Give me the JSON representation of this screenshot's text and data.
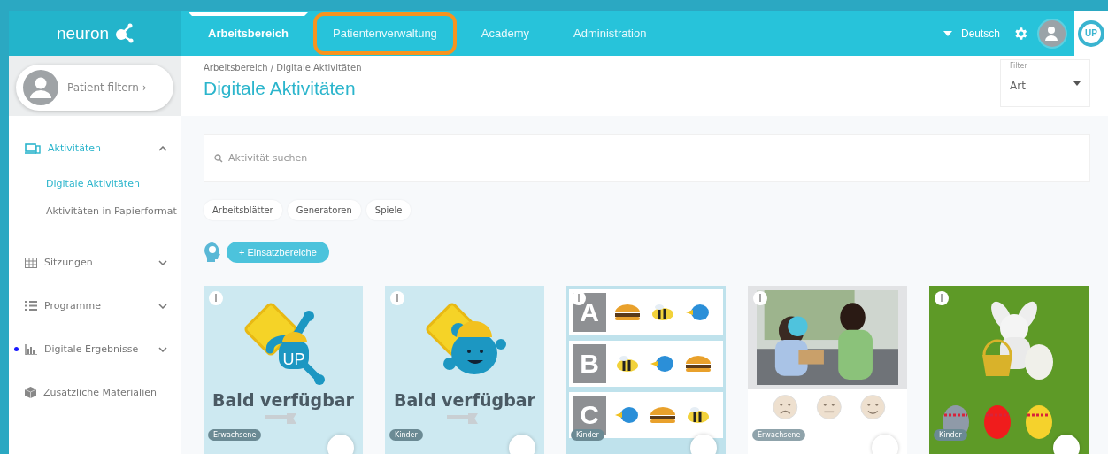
{
  "header": {
    "logo": "neuron",
    "nav": [
      {
        "label": "Arbeitsbereich",
        "selected": true,
        "highlighted": false
      },
      {
        "label": "Patientenverwaltung",
        "selected": false,
        "highlighted": true
      },
      {
        "label": "Academy",
        "selected": false,
        "highlighted": false
      },
      {
        "label": "Administration",
        "selected": false,
        "highlighted": false
      }
    ],
    "language": "Deutsch",
    "brand_badge": "UP"
  },
  "sidebar": {
    "patient_filter": "Patient filtern ›",
    "items": [
      {
        "label": "Aktivitäten",
        "kind": "activities",
        "expanded": true,
        "selected": true,
        "notification": false,
        "children": [
          {
            "label": "Digitale Aktivitäten",
            "selected": true
          },
          {
            "label": "Aktivitäten in Papierformat",
            "selected": false
          }
        ]
      },
      {
        "label": "Sitzungen",
        "kind": "sessions",
        "expanded": false,
        "selected": false,
        "notification": false
      },
      {
        "label": "Programme",
        "kind": "programs",
        "expanded": false,
        "selected": false,
        "notification": false
      },
      {
        "label": "Digitale Ergebnisse",
        "kind": "results",
        "expanded": false,
        "selected": false,
        "notification": true
      },
      {
        "label": "Zusätzliche Materialien",
        "kind": "materials",
        "selected": false,
        "notification": false
      }
    ]
  },
  "breadcrumb": "Arbeitsbereich / Digitale Aktivitäten",
  "page_title": "Digitale Aktivitäten",
  "filter": {
    "label": "Filter",
    "value": "Art"
  },
  "search": {
    "placeholder": "Aktivität suchen"
  },
  "chips": [
    "Arbeitsblätter",
    "Generatoren",
    "Spiele"
  ],
  "areas_button": "+ Einsatzbereiche",
  "cards": [
    {
      "kind": "coming-soon",
      "mascot": {
        "kind": "up",
        "badge_text": "UP"
      },
      "title": "Bald verfügbar",
      "tag": "Erwachsene"
    },
    {
      "kind": "coming-soon",
      "mascot": {
        "kind": "face"
      },
      "title": "Bald verfügbar",
      "tag": "Kinder"
    },
    {
      "kind": "letters",
      "letters": [
        "A",
        "B",
        "C"
      ],
      "tag": "Kinder"
    },
    {
      "tag": "Erwachsene"
    },
    {
      "kind": "easter",
      "tag": "Kinder"
    }
  ]
}
